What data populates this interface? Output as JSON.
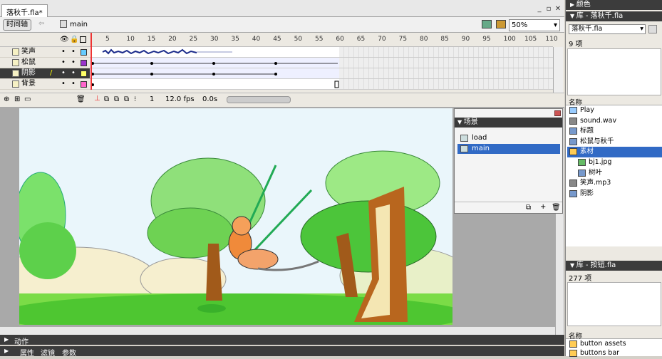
{
  "document": {
    "tab": "落秋千.fla*",
    "scene_crumb": "main",
    "timeline_button": "时间轴",
    "zoom": "50%"
  },
  "timeline": {
    "layers": [
      {
        "name": "笑声",
        "color": "#66ccff",
        "selected": false
      },
      {
        "name": "松鼠",
        "color": "#9933cc",
        "selected": false
      },
      {
        "name": "阴影",
        "color": "#ffff66",
        "selected": true
      },
      {
        "name": "背景",
        "color": "#ff66cc",
        "selected": false
      }
    ],
    "ruler_ticks": [
      "5",
      "10",
      "15",
      "20",
      "25",
      "30",
      "35",
      "40",
      "45",
      "50",
      "55",
      "60",
      "65",
      "70",
      "75",
      "80",
      "85",
      "90",
      "95",
      "100",
      "105",
      "110",
      "11"
    ],
    "current_frame": "1",
    "fps": "12.0 fps",
    "time": "0.0s"
  },
  "scene_panel": {
    "title": "场景",
    "items": [
      {
        "name": "load",
        "selected": false
      },
      {
        "name": "main",
        "selected": true
      }
    ]
  },
  "bottom": {
    "actions": "动作",
    "props_tabs": [
      "属性",
      "滤镜",
      "参数"
    ]
  },
  "right": {
    "color_panel": "颜色",
    "library_title": "库 - 落秋千.fla",
    "library_select": "落秋千.fla",
    "library_count": "9 项",
    "name_header": "名称",
    "items": [
      {
        "name": "Play",
        "icon": "button-icon",
        "indent": 0,
        "selected": false
      },
      {
        "name": "sound.wav",
        "icon": "sound-icon",
        "indent": 0,
        "selected": false
      },
      {
        "name": "标题",
        "icon": "movieclip-icon",
        "indent": 0,
        "selected": false
      },
      {
        "name": "松鼠与秋千",
        "icon": "movieclip-icon",
        "indent": 0,
        "selected": false
      },
      {
        "name": "素材",
        "icon": "folder-icon",
        "indent": 0,
        "selected": true
      },
      {
        "name": "bj1.jpg",
        "icon": "bitmap-icon",
        "indent": 1,
        "selected": false
      },
      {
        "name": "树叶",
        "icon": "movieclip-icon",
        "indent": 1,
        "selected": false
      },
      {
        "name": "笑声.mp3",
        "icon": "sound-icon",
        "indent": 0,
        "selected": false
      },
      {
        "name": "阴影",
        "icon": "movieclip-icon",
        "indent": 0,
        "selected": false
      }
    ],
    "library2_title": "库 - 按钮.fla",
    "library2_count": "277 项",
    "name_header2": "名称",
    "items2": [
      {
        "name": "button assets",
        "icon": "folder-icon"
      },
      {
        "name": "buttons bar",
        "icon": "folder-icon"
      }
    ]
  },
  "colors": {
    "selection": "#316ac5",
    "dark_bar": "#3a3a3a",
    "playhead": "#ee3333"
  }
}
